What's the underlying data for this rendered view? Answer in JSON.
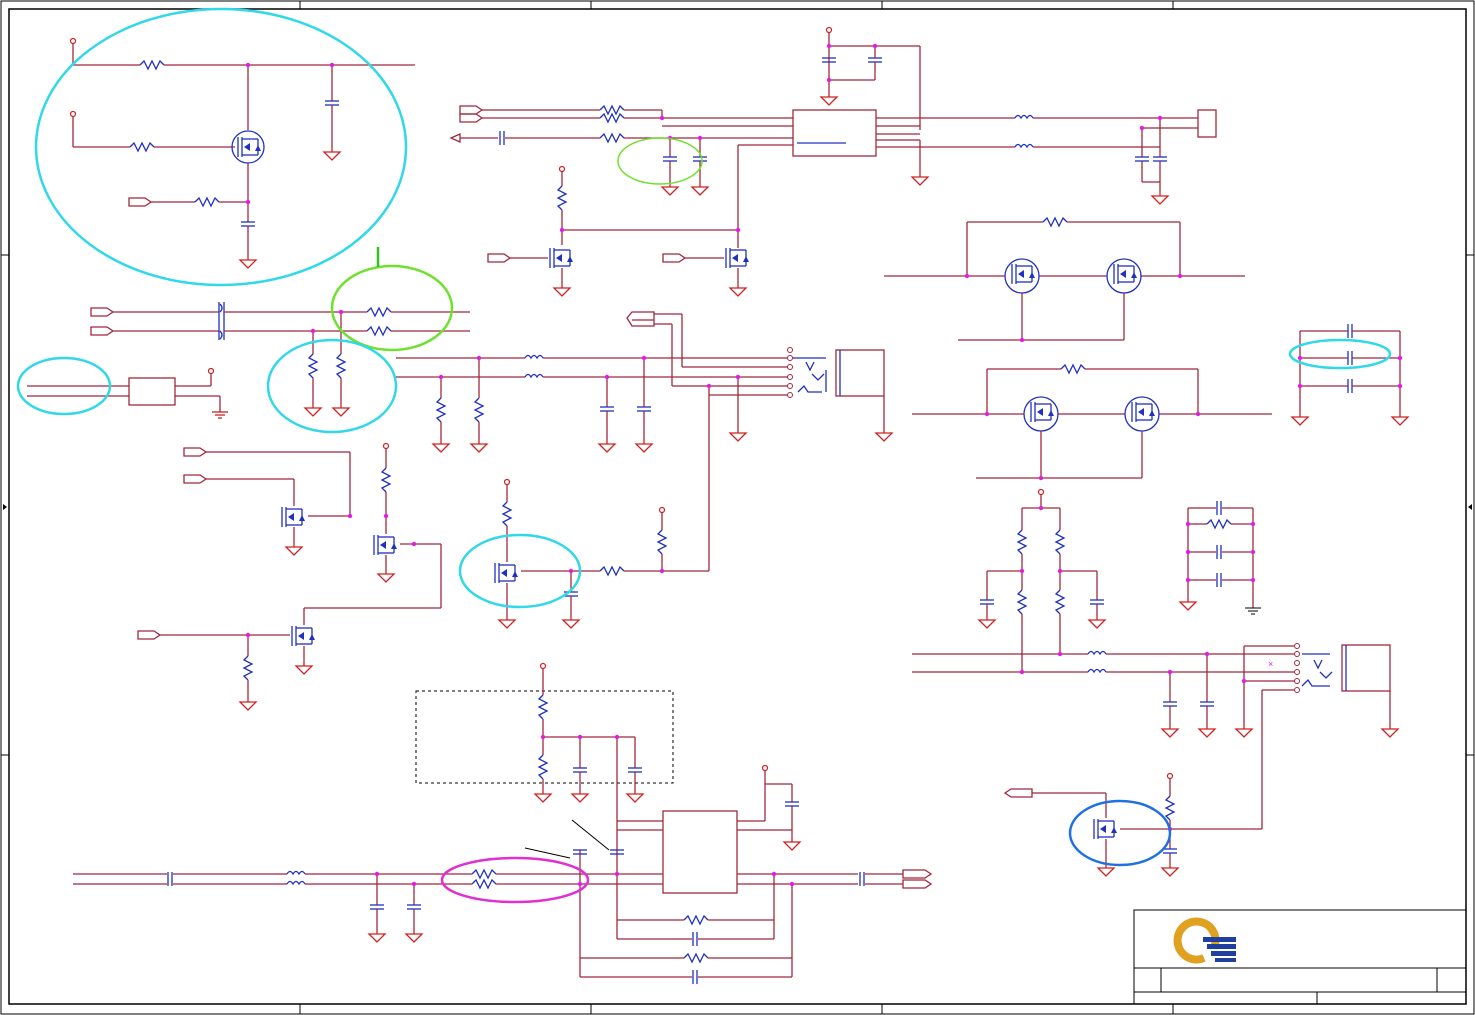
{
  "title_block": {
    "logo": "company-logo"
  },
  "colors": {
    "wire": "#a0283c",
    "component": "#2030c0",
    "ground": "#d02020",
    "junction": "#e020e0",
    "highlight_cyan": "#30d8e8",
    "highlight_green": "#70e030",
    "highlight_magenta": "#e030d0",
    "highlight_blue": "#2070e0"
  }
}
